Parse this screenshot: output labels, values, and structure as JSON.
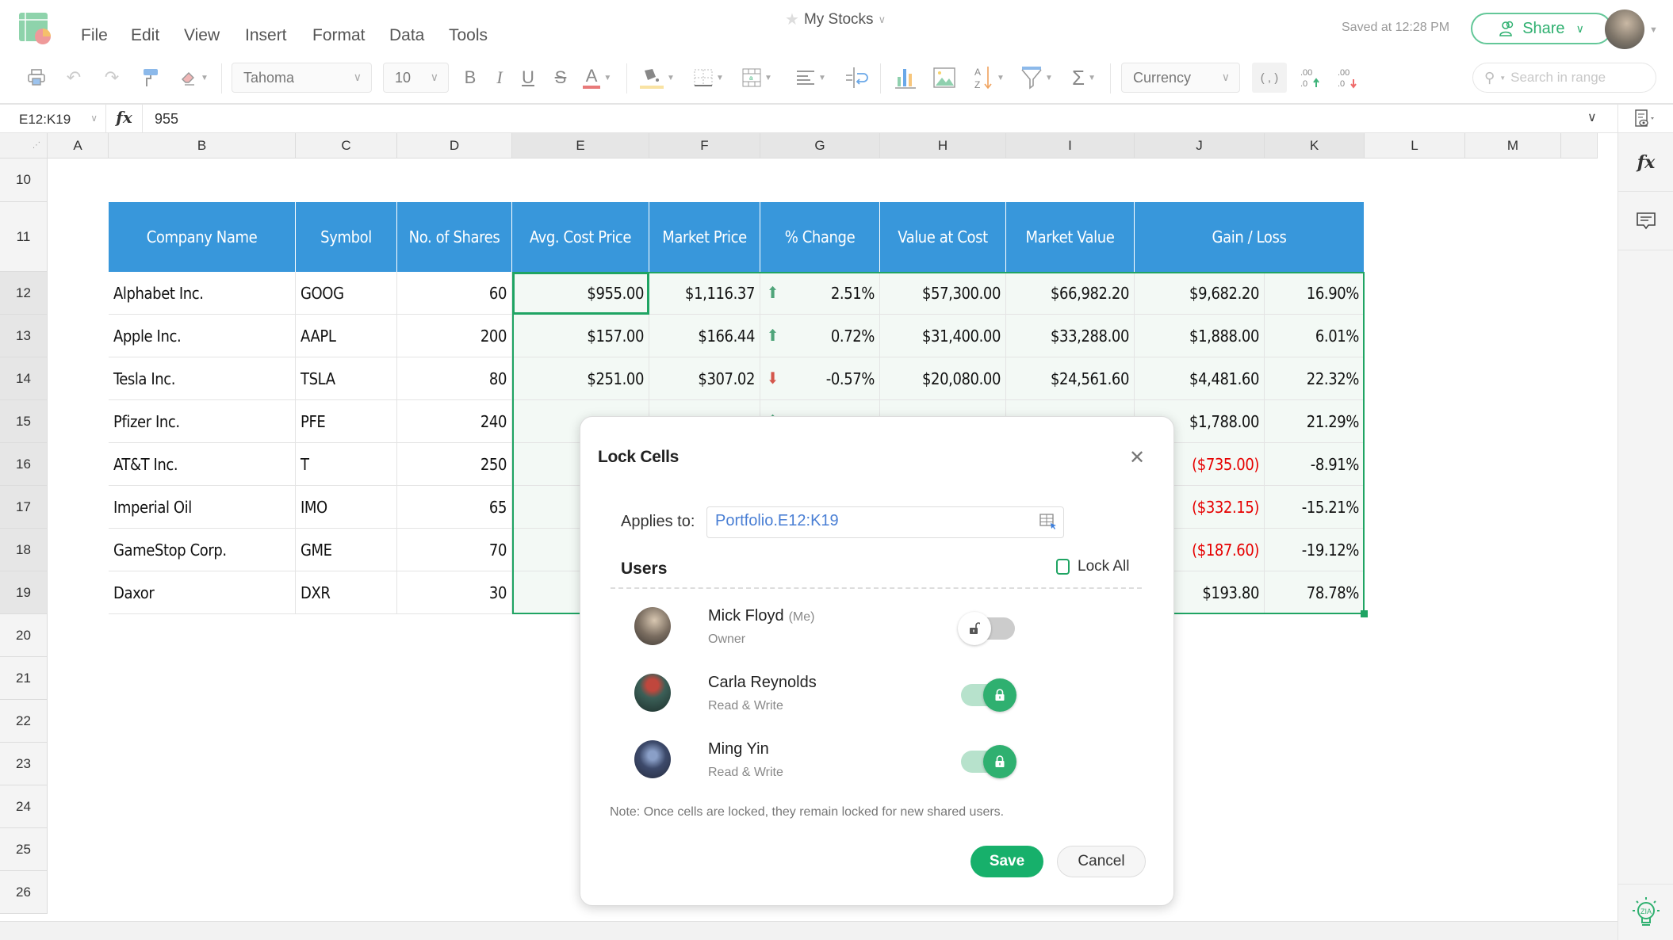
{
  "app": {
    "menu": [
      "File",
      "Edit",
      "View",
      "Insert",
      "Format",
      "Data",
      "Tools"
    ],
    "doc_title": "My Stocks",
    "saved_status": "Saved at 12:28 PM",
    "share_label": "Share"
  },
  "toolbar": {
    "font_family": "Tahoma",
    "font_size": "10",
    "number_format": "Currency",
    "comma_label": "( , )",
    "search_placeholder": "Search in range",
    "icons": [
      "print-icon",
      "undo-icon",
      "redo-icon",
      "paint-format-icon",
      "clear-format-icon",
      "bold-icon",
      "italic-icon",
      "underline-icon",
      "strikethrough-icon",
      "text-color-icon",
      "fill-color-icon",
      "borders-icon",
      "merge-icon",
      "align-icon",
      "wrap-icon",
      "chart-icon",
      "image-icon",
      "sort-icon",
      "filter-icon",
      "sum-icon",
      "increase-decimal-icon",
      "decrease-decimal-icon"
    ],
    "text_color": "#e87a7a",
    "fill_color": "#f9e3a3"
  },
  "formula_bar": {
    "cell_ref": "E12:K19",
    "fx_label": "fx",
    "value": "955"
  },
  "sheet": {
    "columns": [
      "A",
      "B",
      "C",
      "D",
      "E",
      "F",
      "G",
      "H",
      "I",
      "J",
      "K",
      "L",
      "M"
    ],
    "rows": [
      "10",
      "11",
      "12",
      "13",
      "14",
      "15",
      "16",
      "17",
      "18",
      "19",
      "20",
      "21",
      "22",
      "23",
      "24",
      "25",
      "26"
    ],
    "headers": [
      "Company Name",
      "Symbol",
      "No. of Shares",
      "Avg. Cost Price",
      "Market Price",
      "% Change",
      "Value at Cost",
      "Market Value",
      "Gain / Loss"
    ],
    "header_color": "#3897db",
    "selection_color": "#1fa463",
    "data": [
      {
        "company": "Alphabet Inc.",
        "symbol": "GOOG",
        "shares": "60",
        "avg_cost": "$955.00",
        "market_price": "$1,116.37",
        "trend": "up",
        "pct_change": "2.51%",
        "value_at_cost": "$57,300.00",
        "market_value": "$66,982.20",
        "gain": "$9,682.20",
        "gain_pct": "16.90%",
        "gain_negative": false
      },
      {
        "company": "Apple Inc.",
        "symbol": "AAPL",
        "shares": "200",
        "avg_cost": "$157.00",
        "market_price": "$166.44",
        "trend": "up",
        "pct_change": "0.72%",
        "value_at_cost": "$31,400.00",
        "market_value": "$33,288.00",
        "gain": "$1,888.00",
        "gain_pct": "6.01%",
        "gain_negative": false
      },
      {
        "company": "Tesla Inc.",
        "symbol": "TSLA",
        "shares": "80",
        "avg_cost": "$251.00",
        "market_price": "$307.02",
        "trend": "down",
        "pct_change": "-0.57%",
        "value_at_cost": "$20,080.00",
        "market_value": "$24,561.60",
        "gain": "$4,481.60",
        "gain_pct": "22.32%",
        "gain_negative": false
      },
      {
        "company": "Pfizer Inc.",
        "symbol": "PFE",
        "shares": "240",
        "trend": "up",
        "gain": "$1,788.00",
        "gain_pct": "21.29%",
        "gain_negative": false
      },
      {
        "company": "AT&T Inc.",
        "symbol": "T",
        "shares": "250",
        "gain": "($735.00)",
        "gain_pct": "-8.91%",
        "gain_negative": true
      },
      {
        "company": "Imperial Oil",
        "symbol": "IMO",
        "shares": "65",
        "gain": "($332.15)",
        "gain_pct": "-15.21%",
        "gain_negative": true
      },
      {
        "company": "GameStop Corp.",
        "symbol": "GME",
        "shares": "70",
        "gain": "($187.60)",
        "gain_pct": "-19.12%",
        "gain_negative": true
      },
      {
        "company": "Daxor",
        "symbol": "DXR",
        "shares": "30",
        "gain": "$193.80",
        "gain_pct": "78.78%",
        "gain_negative": false
      }
    ]
  },
  "dialog": {
    "title": "Lock Cells",
    "applies_to_label": "Applies to:",
    "applies_to_value": "Portfolio.E12:K19",
    "users_label": "Users",
    "lock_all_label": "Lock All",
    "lock_all_checked": false,
    "users": [
      {
        "name": "Mick Floyd",
        "me_tag": "(Me)",
        "role": "Owner",
        "locked": false
      },
      {
        "name": "Carla Reynolds",
        "me_tag": "",
        "role": "Read & Write",
        "locked": true
      },
      {
        "name": "Ming Yin",
        "me_tag": "",
        "role": "Read & Write",
        "locked": true
      }
    ],
    "note": "Note:  Once cells are locked, they remain locked for new shared users.",
    "save_label": "Save",
    "cancel_label": "Cancel"
  }
}
